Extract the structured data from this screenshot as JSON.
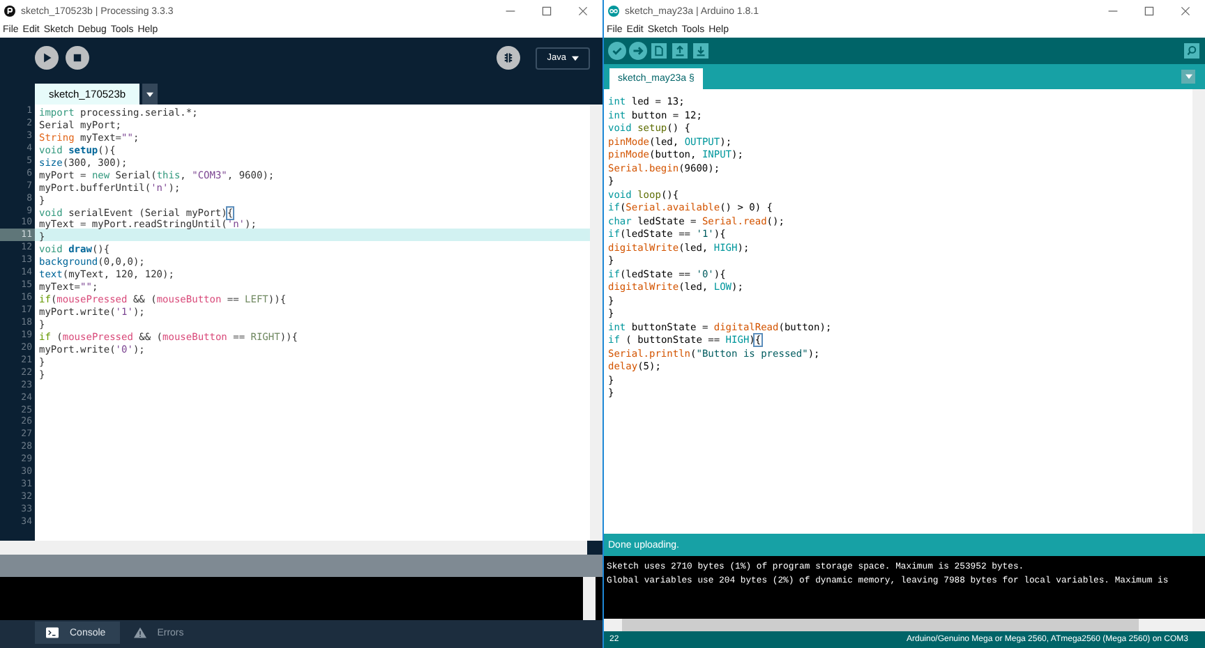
{
  "processing": {
    "window": {
      "title": "sketch_170523b | Processing 3.3.3"
    },
    "menu": [
      "File",
      "Edit",
      "Sketch",
      "Debug",
      "Tools",
      "Help"
    ],
    "mode": "Java",
    "tabs": [
      {
        "label": "sketch_170523b",
        "selected": true
      }
    ],
    "line_numbers": [
      "1",
      "2",
      "3",
      "4",
      "5",
      "6",
      "7",
      "8",
      "9",
      "10",
      "11",
      "12",
      "13",
      "14",
      "15",
      "16",
      "17",
      "18",
      "19",
      "20",
      "21",
      "22",
      "23",
      "24",
      "25",
      "26",
      "27",
      "28",
      "29",
      "30",
      "31",
      "32",
      "33",
      "34"
    ],
    "lines": [
      {
        "current": false,
        "tokens": [
          {
            "text": "import",
            "kind": "kw"
          },
          {
            "text": " processing.serial.*;",
            "kind": "plain"
          }
        ]
      },
      {
        "current": false,
        "tokens": [
          {
            "text": "Serial myPort;",
            "kind": "plain"
          }
        ]
      },
      {
        "current": false,
        "tokens": [
          {
            "text": "String",
            "kind": "type"
          },
          {
            "text": " myText=",
            "kind": "plain"
          },
          {
            "text": "\"\"",
            "kind": "str"
          },
          {
            "text": ";",
            "kind": "plain"
          }
        ]
      },
      {
        "current": false,
        "tokens": [
          {
            "text": "void ",
            "kind": "kw"
          },
          {
            "text": "setup",
            "kind": "fn"
          },
          {
            "text": "(){",
            "kind": "plain"
          }
        ]
      },
      {
        "current": false,
        "tokens": [
          {
            "text": "size",
            "kind": "builtin"
          },
          {
            "text": "(300, 300);",
            "kind": "plain"
          }
        ]
      },
      {
        "current": false,
        "tokens": [
          {
            "text": "myPort = ",
            "kind": "plain"
          },
          {
            "text": "new",
            "kind": "kw"
          },
          {
            "text": " Serial(",
            "kind": "plain"
          },
          {
            "text": "this",
            "kind": "kw"
          },
          {
            "text": ", ",
            "kind": "plain"
          },
          {
            "text": "\"COM3\"",
            "kind": "str"
          },
          {
            "text": ", 9600);",
            "kind": "plain"
          }
        ]
      },
      {
        "current": false,
        "tokens": [
          {
            "text": "myPort.bufferUntil(",
            "kind": "plain"
          },
          {
            "text": "'n'",
            "kind": "str"
          },
          {
            "text": ");",
            "kind": "plain"
          }
        ]
      },
      {
        "current": false,
        "tokens": [
          {
            "text": "}",
            "kind": "plain"
          }
        ]
      },
      {
        "current": false,
        "tokens": [
          {
            "text": "void",
            "kind": "kw"
          },
          {
            "text": " serialEvent (Serial myPort)",
            "kind": "plain"
          },
          {
            "text": "{",
            "kind": "bracket"
          }
        ]
      },
      {
        "current": false,
        "tokens": [
          {
            "text": "myText = myPort.readStringUntil(",
            "kind": "plain"
          },
          {
            "text": "'n'",
            "kind": "str"
          },
          {
            "text": ");",
            "kind": "plain"
          }
        ]
      },
      {
        "current": true,
        "tokens": [
          {
            "text": "}",
            "kind": "plain"
          }
        ]
      },
      {
        "current": false,
        "tokens": [
          {
            "text": "void ",
            "kind": "kw"
          },
          {
            "text": "draw",
            "kind": "fn"
          },
          {
            "text": "(){",
            "kind": "plain"
          }
        ]
      },
      {
        "current": false,
        "tokens": [
          {
            "text": "background",
            "kind": "builtin"
          },
          {
            "text": "(0,0,0);",
            "kind": "plain"
          }
        ]
      },
      {
        "current": false,
        "tokens": [
          {
            "text": "text",
            "kind": "builtin"
          },
          {
            "text": "(myText, 120, 120);",
            "kind": "plain"
          }
        ]
      },
      {
        "current": false,
        "tokens": [
          {
            "text": "myText=",
            "kind": "plain"
          },
          {
            "text": "\"\"",
            "kind": "str"
          },
          {
            "text": ";",
            "kind": "plain"
          }
        ]
      },
      {
        "current": false,
        "tokens": [
          {
            "text": "if",
            "kind": "ctl"
          },
          {
            "text": "(",
            "kind": "plain"
          },
          {
            "text": "mousePressed",
            "kind": "var"
          },
          {
            "text": " && (",
            "kind": "plain"
          },
          {
            "text": "mouseButton",
            "kind": "var"
          },
          {
            "text": " == ",
            "kind": "plain"
          },
          {
            "text": "LEFT",
            "kind": "const"
          },
          {
            "text": ")){",
            "kind": "plain"
          }
        ]
      },
      {
        "current": false,
        "tokens": [
          {
            "text": "myPort.write(",
            "kind": "plain"
          },
          {
            "text": "'1'",
            "kind": "str"
          },
          {
            "text": ");",
            "kind": "plain"
          }
        ]
      },
      {
        "current": false,
        "tokens": [
          {
            "text": "}",
            "kind": "plain"
          }
        ]
      },
      {
        "current": false,
        "tokens": [
          {
            "text": "if",
            "kind": "ctl"
          },
          {
            "text": " (",
            "kind": "plain"
          },
          {
            "text": "mousePressed",
            "kind": "var"
          },
          {
            "text": " && (",
            "kind": "plain"
          },
          {
            "text": "mouseButton",
            "kind": "var"
          },
          {
            "text": " == ",
            "kind": "plain"
          },
          {
            "text": "RIGHT",
            "kind": "const"
          },
          {
            "text": ")){",
            "kind": "plain"
          }
        ]
      },
      {
        "current": false,
        "tokens": [
          {
            "text": "myPort.write(",
            "kind": "plain"
          },
          {
            "text": "'0'",
            "kind": "str"
          },
          {
            "text": ");",
            "kind": "plain"
          }
        ]
      },
      {
        "current": false,
        "tokens": [
          {
            "text": "}",
            "kind": "plain"
          }
        ]
      },
      {
        "current": false,
        "tokens": [
          {
            "text": "}",
            "kind": "plain"
          }
        ]
      }
    ],
    "console_tabs": [
      {
        "label": "Console",
        "selected": true,
        "kind": "console"
      },
      {
        "label": "Errors",
        "selected": false,
        "kind": "errors"
      }
    ]
  },
  "arduino": {
    "window": {
      "title": "sketch_may23a | Arduino 1.8.1"
    },
    "menu": [
      "File",
      "Edit",
      "Sketch",
      "Tools",
      "Help"
    ],
    "tabs": [
      {
        "label": "sketch_may23a §",
        "selected": true
      }
    ],
    "lines": [
      {
        "tokens": [
          {
            "text": "int",
            "kind": "kw"
          },
          {
            "text": " led = 13;",
            "kind": "plain"
          }
        ]
      },
      {
        "tokens": [
          {
            "text": "int",
            "kind": "kw"
          },
          {
            "text": " button = 12;",
            "kind": "plain"
          }
        ]
      },
      {
        "tokens": [
          {
            "text": "void ",
            "kind": "kw"
          },
          {
            "text": "setup",
            "kind": "fn"
          },
          {
            "text": "() {",
            "kind": "plain"
          }
        ]
      },
      {
        "tokens": [
          {
            "text": "pinMode",
            "kind": "builtin"
          },
          {
            "text": "(led, ",
            "kind": "plain"
          },
          {
            "text": "OUTPUT",
            "kind": "const"
          },
          {
            "text": ");",
            "kind": "plain"
          }
        ]
      },
      {
        "tokens": [
          {
            "text": "pinMode",
            "kind": "builtin"
          },
          {
            "text": "(button, ",
            "kind": "plain"
          },
          {
            "text": "INPUT",
            "kind": "const"
          },
          {
            "text": ");",
            "kind": "plain"
          }
        ]
      },
      {
        "tokens": [
          {
            "text": "Serial.begin",
            "kind": "builtin"
          },
          {
            "text": "(9600);",
            "kind": "plain"
          }
        ]
      },
      {
        "tokens": [
          {
            "text": "}",
            "kind": "plain"
          }
        ]
      },
      {
        "tokens": [
          {
            "text": "void ",
            "kind": "kw"
          },
          {
            "text": "loop",
            "kind": "fn"
          },
          {
            "text": "(){",
            "kind": "plain"
          }
        ]
      },
      {
        "tokens": [
          {
            "text": "if",
            "kind": "kw"
          },
          {
            "text": "(",
            "kind": "plain"
          },
          {
            "text": "Serial.available",
            "kind": "builtin"
          },
          {
            "text": "() > 0) {",
            "kind": "plain"
          }
        ]
      },
      {
        "tokens": [
          {
            "text": "char",
            "kind": "kw"
          },
          {
            "text": " ledState = ",
            "kind": "plain"
          },
          {
            "text": "Serial.read",
            "kind": "builtin"
          },
          {
            "text": "();",
            "kind": "plain"
          }
        ]
      },
      {
        "tokens": [
          {
            "text": "if",
            "kind": "kw"
          },
          {
            "text": "(ledState == ",
            "kind": "plain"
          },
          {
            "text": "'1'",
            "kind": "str"
          },
          {
            "text": "){",
            "kind": "plain"
          }
        ]
      },
      {
        "tokens": [
          {
            "text": "digitalWrite",
            "kind": "builtin"
          },
          {
            "text": "(led, ",
            "kind": "plain"
          },
          {
            "text": "HIGH",
            "kind": "const"
          },
          {
            "text": ");",
            "kind": "plain"
          }
        ]
      },
      {
        "tokens": [
          {
            "text": "}",
            "kind": "plain"
          }
        ]
      },
      {
        "tokens": [
          {
            "text": "if",
            "kind": "kw"
          },
          {
            "text": "(ledState == ",
            "kind": "plain"
          },
          {
            "text": "'0'",
            "kind": "str"
          },
          {
            "text": "){",
            "kind": "plain"
          }
        ]
      },
      {
        "tokens": [
          {
            "text": "digitalWrite",
            "kind": "builtin"
          },
          {
            "text": "(led, ",
            "kind": "plain"
          },
          {
            "text": "LOW",
            "kind": "const"
          },
          {
            "text": ");",
            "kind": "plain"
          }
        ]
      },
      {
        "tokens": [
          {
            "text": "}",
            "kind": "plain"
          }
        ]
      },
      {
        "tokens": [
          {
            "text": "}",
            "kind": "plain"
          }
        ]
      },
      {
        "tokens": [
          {
            "text": "int",
            "kind": "kw"
          },
          {
            "text": " buttonState = ",
            "kind": "plain"
          },
          {
            "text": "digitalRead",
            "kind": "builtin"
          },
          {
            "text": "(button);",
            "kind": "plain"
          }
        ]
      },
      {
        "tokens": [
          {
            "text": "if",
            "kind": "kw"
          },
          {
            "text": " ( buttonState == ",
            "kind": "plain"
          },
          {
            "text": "HIGH",
            "kind": "const"
          },
          {
            "text": ")",
            "kind": "plain"
          },
          {
            "text": "{",
            "kind": "bracket"
          }
        ]
      },
      {
        "tokens": [
          {
            "text": "Serial.println",
            "kind": "builtin"
          },
          {
            "text": "(",
            "kind": "plain"
          },
          {
            "text": "\"Button is pressed\"",
            "kind": "str"
          },
          {
            "text": ");",
            "kind": "plain"
          }
        ]
      },
      {
        "tokens": [
          {
            "text": "delay",
            "kind": "builtin"
          },
          {
            "text": "(5);",
            "kind": "plain"
          }
        ]
      },
      {
        "tokens": [
          {
            "text": "}",
            "kind": "plain"
          }
        ]
      },
      {
        "tokens": [
          {
            "text": "}",
            "kind": "plain"
          }
        ]
      }
    ],
    "message": "Done uploading.",
    "console": [
      "Sketch uses 2710 bytes (1%) of program storage space. Maximum is 253952 bytes.",
      "Global variables use 204 bytes (2%) of dynamic memory, leaving 7988 bytes for local variables. Maximum is"
    ],
    "status_bar": {
      "line": "22",
      "board": "Arduino/Genuino Mega or Mega 2560, ATmega2560 (Mega 2560) on COM3"
    }
  }
}
